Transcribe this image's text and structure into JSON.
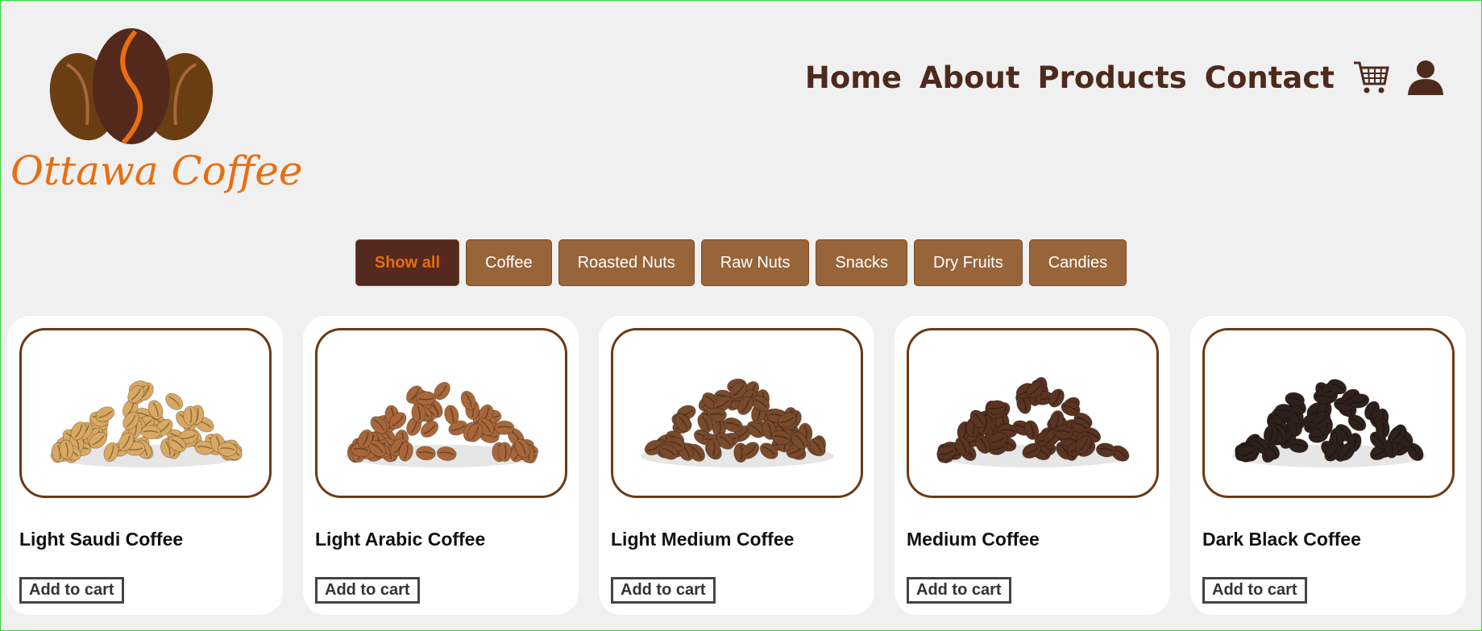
{
  "brand": {
    "name": "Ottawa Coffee",
    "logo_icon": "coffee-beans-icon"
  },
  "nav": {
    "links": [
      "Home",
      "About",
      "Products",
      "Contact"
    ],
    "cart_icon": "cart-icon",
    "user_icon": "user-icon"
  },
  "filters": {
    "items": [
      "Show all",
      "Coffee",
      "Roasted Nuts",
      "Raw Nuts",
      "Snacks",
      "Dry Fruits",
      "Candies"
    ],
    "active": "Show all"
  },
  "products": [
    {
      "name": "Light Saudi Coffee",
      "button": "Add to cart",
      "bean_color": "#d9a861"
    },
    {
      "name": "Light Arabic Coffee",
      "button": "Add to cart",
      "bean_color": "#a8673a"
    },
    {
      "name": "Light Medium Coffee",
      "button": "Add to cart",
      "bean_color": "#7a4a2c"
    },
    {
      "name": "Medium Coffee",
      "button": "Add to cart",
      "bean_color": "#5a3322"
    },
    {
      "name": "Dark Black Coffee",
      "button": "Add to cart",
      "bean_color": "#2e211c"
    }
  ],
  "colors": {
    "brand_orange": "#e86e10",
    "dark_brown": "#54291e",
    "filter_brown": "#98643a",
    "card_border": "#6c3a13"
  }
}
